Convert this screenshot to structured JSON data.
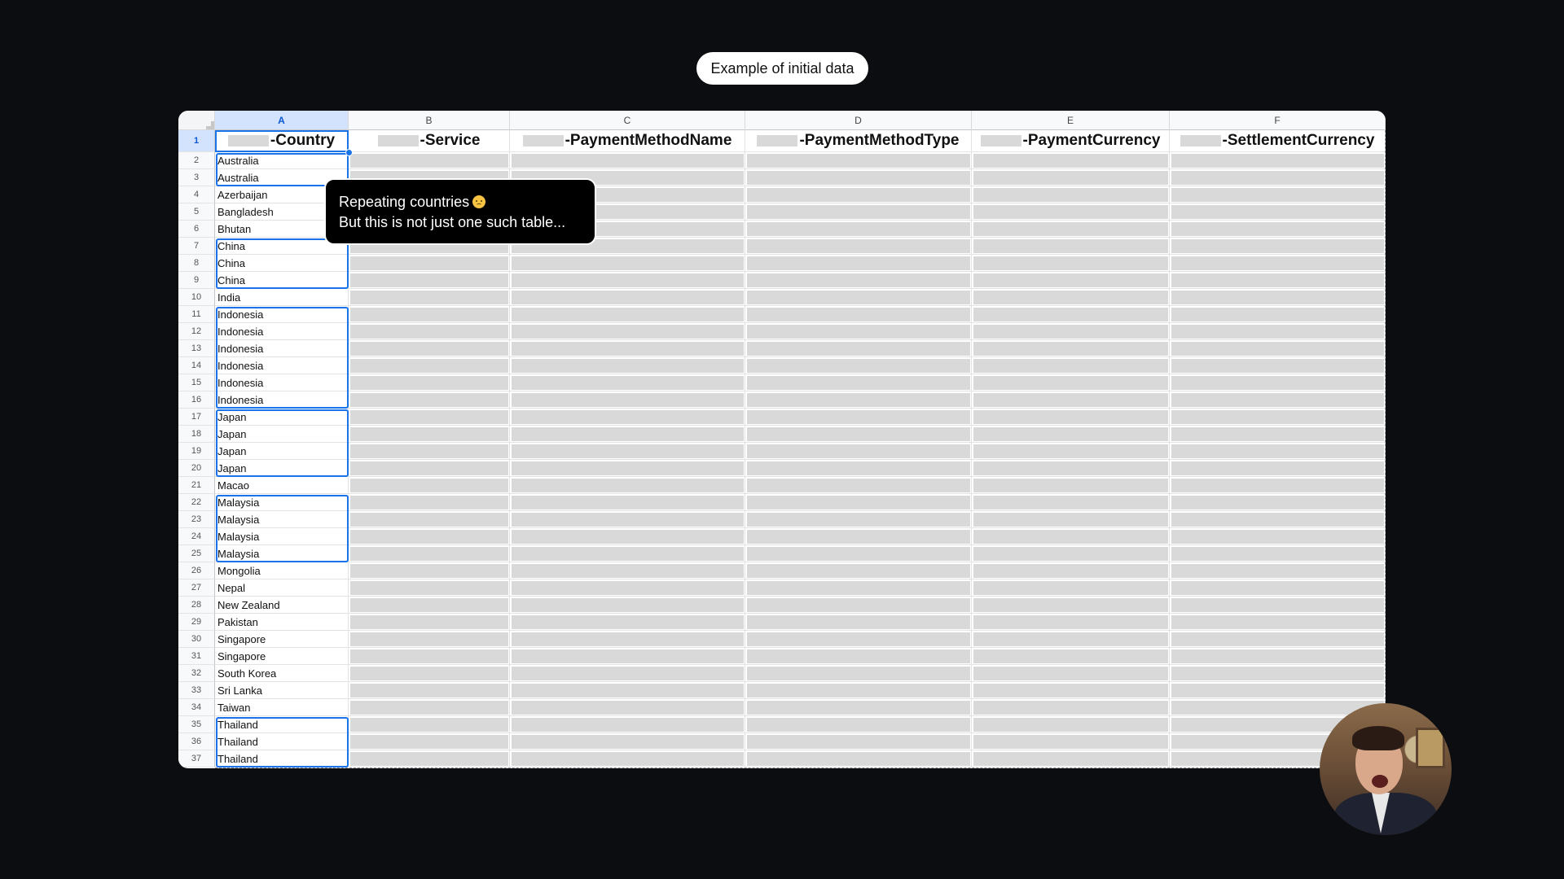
{
  "caption": "Example of initial data",
  "tooltip": {
    "line1": "Repeating countries",
    "line2": "But this is not just one such table..."
  },
  "emoji_icon": "worried-face-icon",
  "sheet": {
    "selected_cell": "A1",
    "columns": [
      {
        "letter": "A",
        "header": "-Country"
      },
      {
        "letter": "B",
        "header": "-Service"
      },
      {
        "letter": "C",
        "header": "-PaymentMethodName"
      },
      {
        "letter": "D",
        "header": "-PaymentMethodType"
      },
      {
        "letter": "E",
        "header": "-PaymentCurrency"
      },
      {
        "letter": "F",
        "header": "-SettlementCurrency"
      }
    ],
    "rows": [
      {
        "num": "1"
      },
      {
        "num": "2",
        "country": "Australia"
      },
      {
        "num": "3",
        "country": "Australia"
      },
      {
        "num": "4",
        "country": "Azerbaijan"
      },
      {
        "num": "5",
        "country": "Bangladesh"
      },
      {
        "num": "6",
        "country": "Bhutan"
      },
      {
        "num": "7",
        "country": "China"
      },
      {
        "num": "8",
        "country": "China"
      },
      {
        "num": "9",
        "country": "China"
      },
      {
        "num": "10",
        "country": "India"
      },
      {
        "num": "11",
        "country": "Indonesia"
      },
      {
        "num": "12",
        "country": "Indonesia"
      },
      {
        "num": "13",
        "country": "Indonesia"
      },
      {
        "num": "14",
        "country": "Indonesia"
      },
      {
        "num": "15",
        "country": "Indonesia"
      },
      {
        "num": "16",
        "country": "Indonesia"
      },
      {
        "num": "17",
        "country": "Japan"
      },
      {
        "num": "18",
        "country": "Japan"
      },
      {
        "num": "19",
        "country": "Japan"
      },
      {
        "num": "20",
        "country": "Japan"
      },
      {
        "num": "21",
        "country": "Macao"
      },
      {
        "num": "22",
        "country": "Malaysia"
      },
      {
        "num": "23",
        "country": "Malaysia"
      },
      {
        "num": "24",
        "country": "Malaysia"
      },
      {
        "num": "25",
        "country": "Malaysia"
      },
      {
        "num": "26",
        "country": "Mongolia"
      },
      {
        "num": "27",
        "country": "Nepal"
      },
      {
        "num": "28",
        "country": "New Zealand"
      },
      {
        "num": "29",
        "country": "Pakistan"
      },
      {
        "num": "30",
        "country": "Singapore"
      },
      {
        "num": "31",
        "country": "Singapore"
      },
      {
        "num": "32",
        "country": "South Korea"
      },
      {
        "num": "33",
        "country": "Sri Lanka"
      },
      {
        "num": "34",
        "country": "Taiwan"
      },
      {
        "num": "35",
        "country": "Thailand"
      },
      {
        "num": "36",
        "country": "Thailand"
      },
      {
        "num": "37",
        "country": "Thailand"
      }
    ],
    "highlighted_groups": [
      "Australia",
      "China",
      "Indonesia",
      "Japan",
      "Malaysia",
      "Thailand"
    ]
  },
  "colors": {
    "background": "#0c0d11",
    "group_highlight": "#1a73e8",
    "redacted": "#d9d9d9"
  },
  "avatar_icon": "shocked-presenter-avatar"
}
